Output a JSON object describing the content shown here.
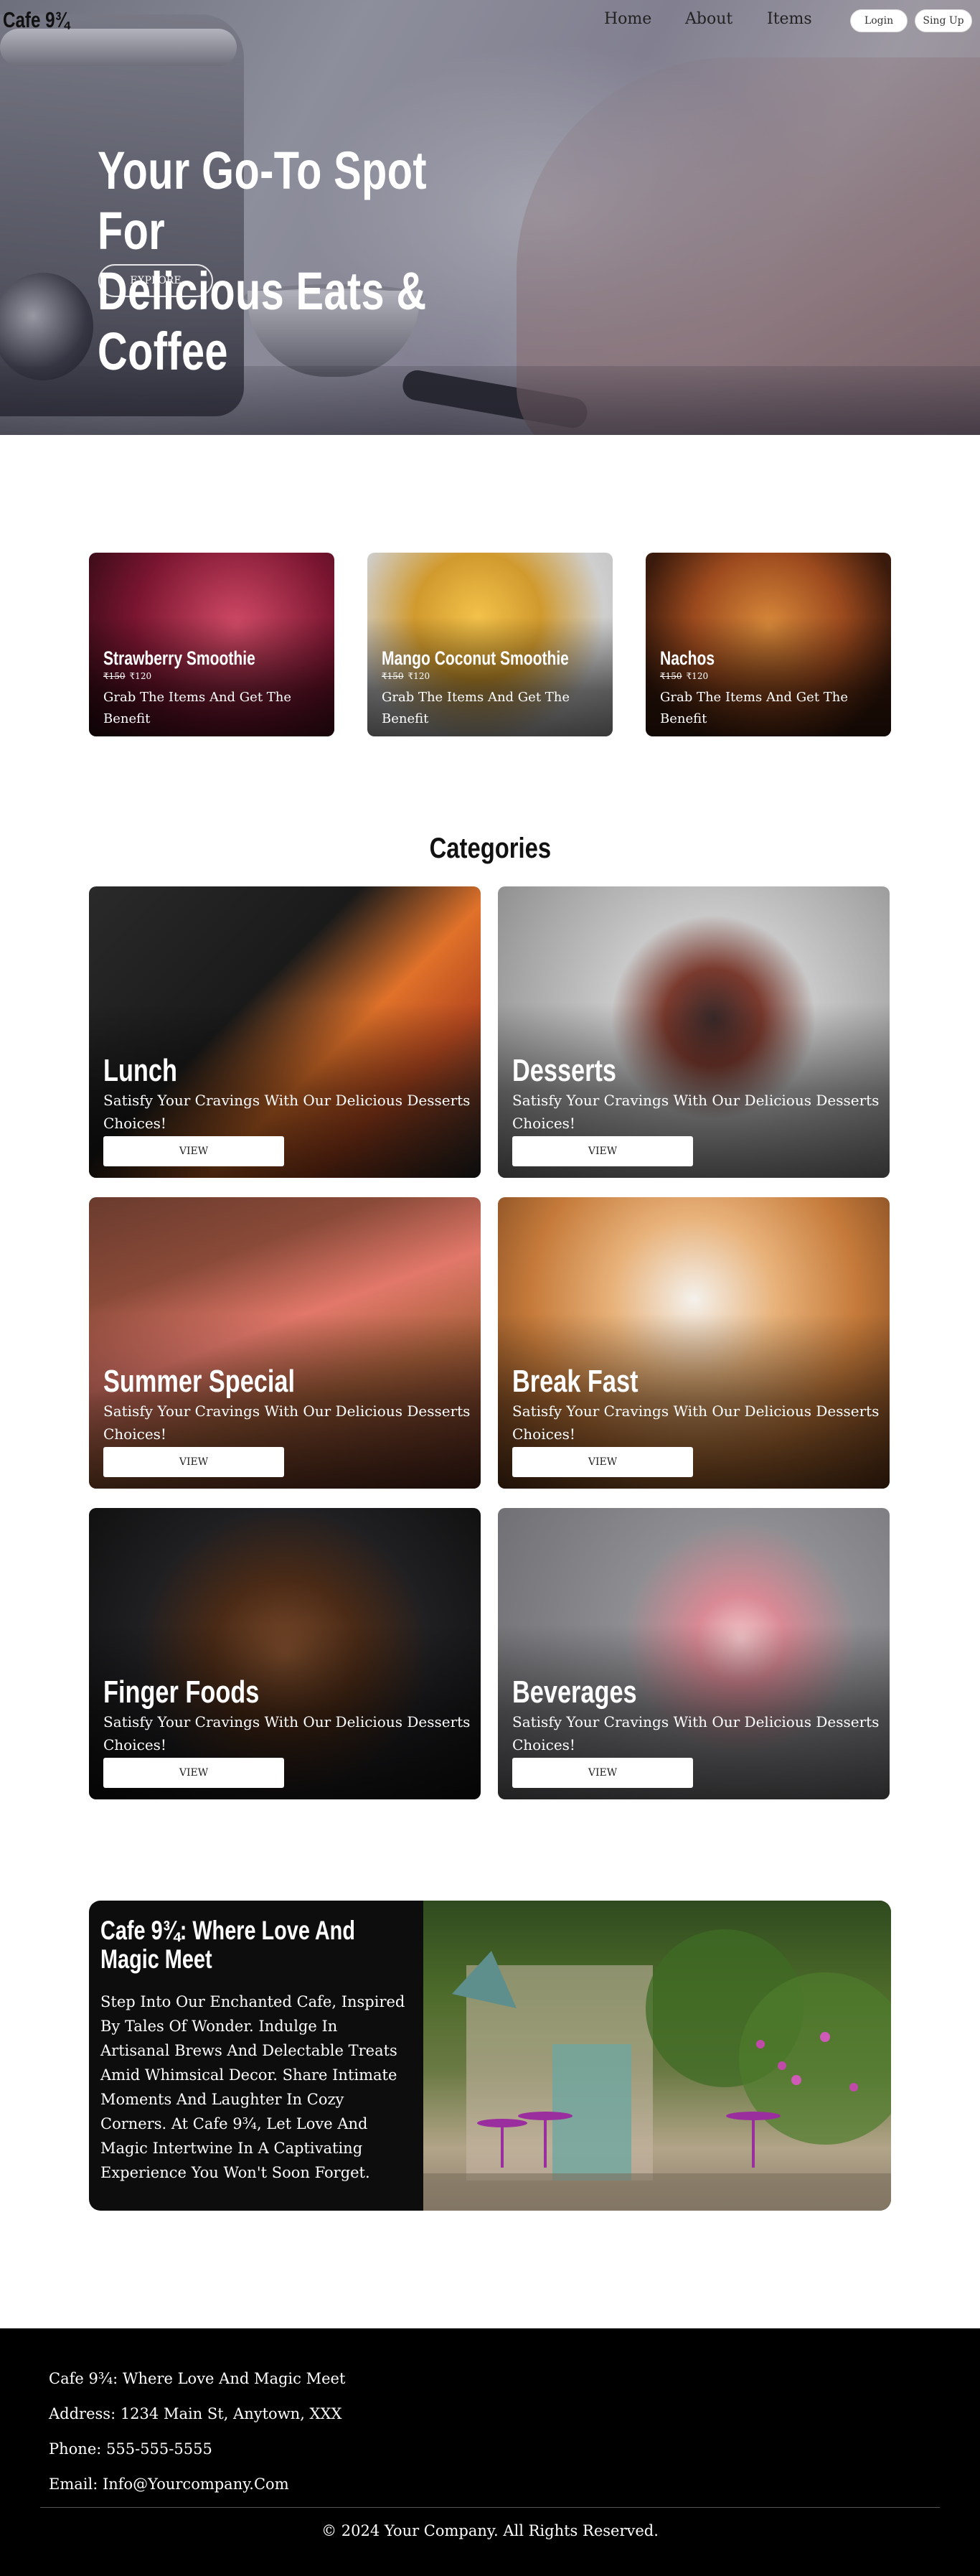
{
  "nav": {
    "logo": "Cafe 9¾",
    "links": [
      "Home",
      "About",
      "Items"
    ],
    "login": "Login",
    "signup": "Sing Up"
  },
  "hero": {
    "title_line1": "Your Go-To Spot For",
    "title_line2": "Delicious Eats & Coffee",
    "cta": "EXPLORE"
  },
  "featured": [
    {
      "name": "Strawberry Smoothie",
      "old_price": "₹150",
      "price": "₹120",
      "desc": "Grab The Items And Get The Benefit",
      "color": "#b8304c"
    },
    {
      "name": "Mango Coconut Smoothie",
      "old_price": "₹150",
      "price": "₹120",
      "desc": "Grab The Items And Get The Benefit",
      "color": "#e7b04a"
    },
    {
      "name": "Nachos",
      "old_price": "₹150",
      "price": "₹120",
      "desc": "Grab The Items And Get The Benefit",
      "color": "#b85a20"
    }
  ],
  "categories": {
    "heading": "Categories",
    "button_label": "VIEW",
    "items": [
      {
        "name": "Lunch",
        "desc": "Satisfy Your Cravings With Our Delicious Desserts Choices!"
      },
      {
        "name": "Desserts",
        "desc": "Satisfy Your Cravings With Our Delicious Desserts Choices!"
      },
      {
        "name": "Summer Special",
        "desc": "Satisfy Your Cravings With Our Delicious Desserts Choices!"
      },
      {
        "name": "Break Fast",
        "desc": "Satisfy Your Cravings With Our Delicious Desserts Choices!"
      },
      {
        "name": "Finger Foods",
        "desc": "Satisfy Your Cravings With Our Delicious Desserts Choices!"
      },
      {
        "name": "Beverages",
        "desc": "Satisfy Your Cravings With Our Delicious Desserts Choices!"
      }
    ]
  },
  "about": {
    "title": "Cafe 9¾: Where Love And Magic Meet",
    "text": "Step Into Our Enchanted Cafe, Inspired By Tales Of Wonder. Indulge In Artisanal Brews And Delectable Treats Amid Whimsical Decor. Share Intimate Moments And Laughter In Cozy Corners. At Cafe 9¾, Let Love And Magic Intertwine In A Captivating Experience You Won't Soon Forget."
  },
  "footer": {
    "tagline": "Cafe 9¾: Where Love And Magic Meet",
    "address": "Address: 1234 Main St, Anytown, XXX",
    "phone": "Phone: 555-555-5555",
    "email": "Email: Info@Yourcompany.Com",
    "copyright": "© 2024 Your Company. All Rights Reserved."
  }
}
